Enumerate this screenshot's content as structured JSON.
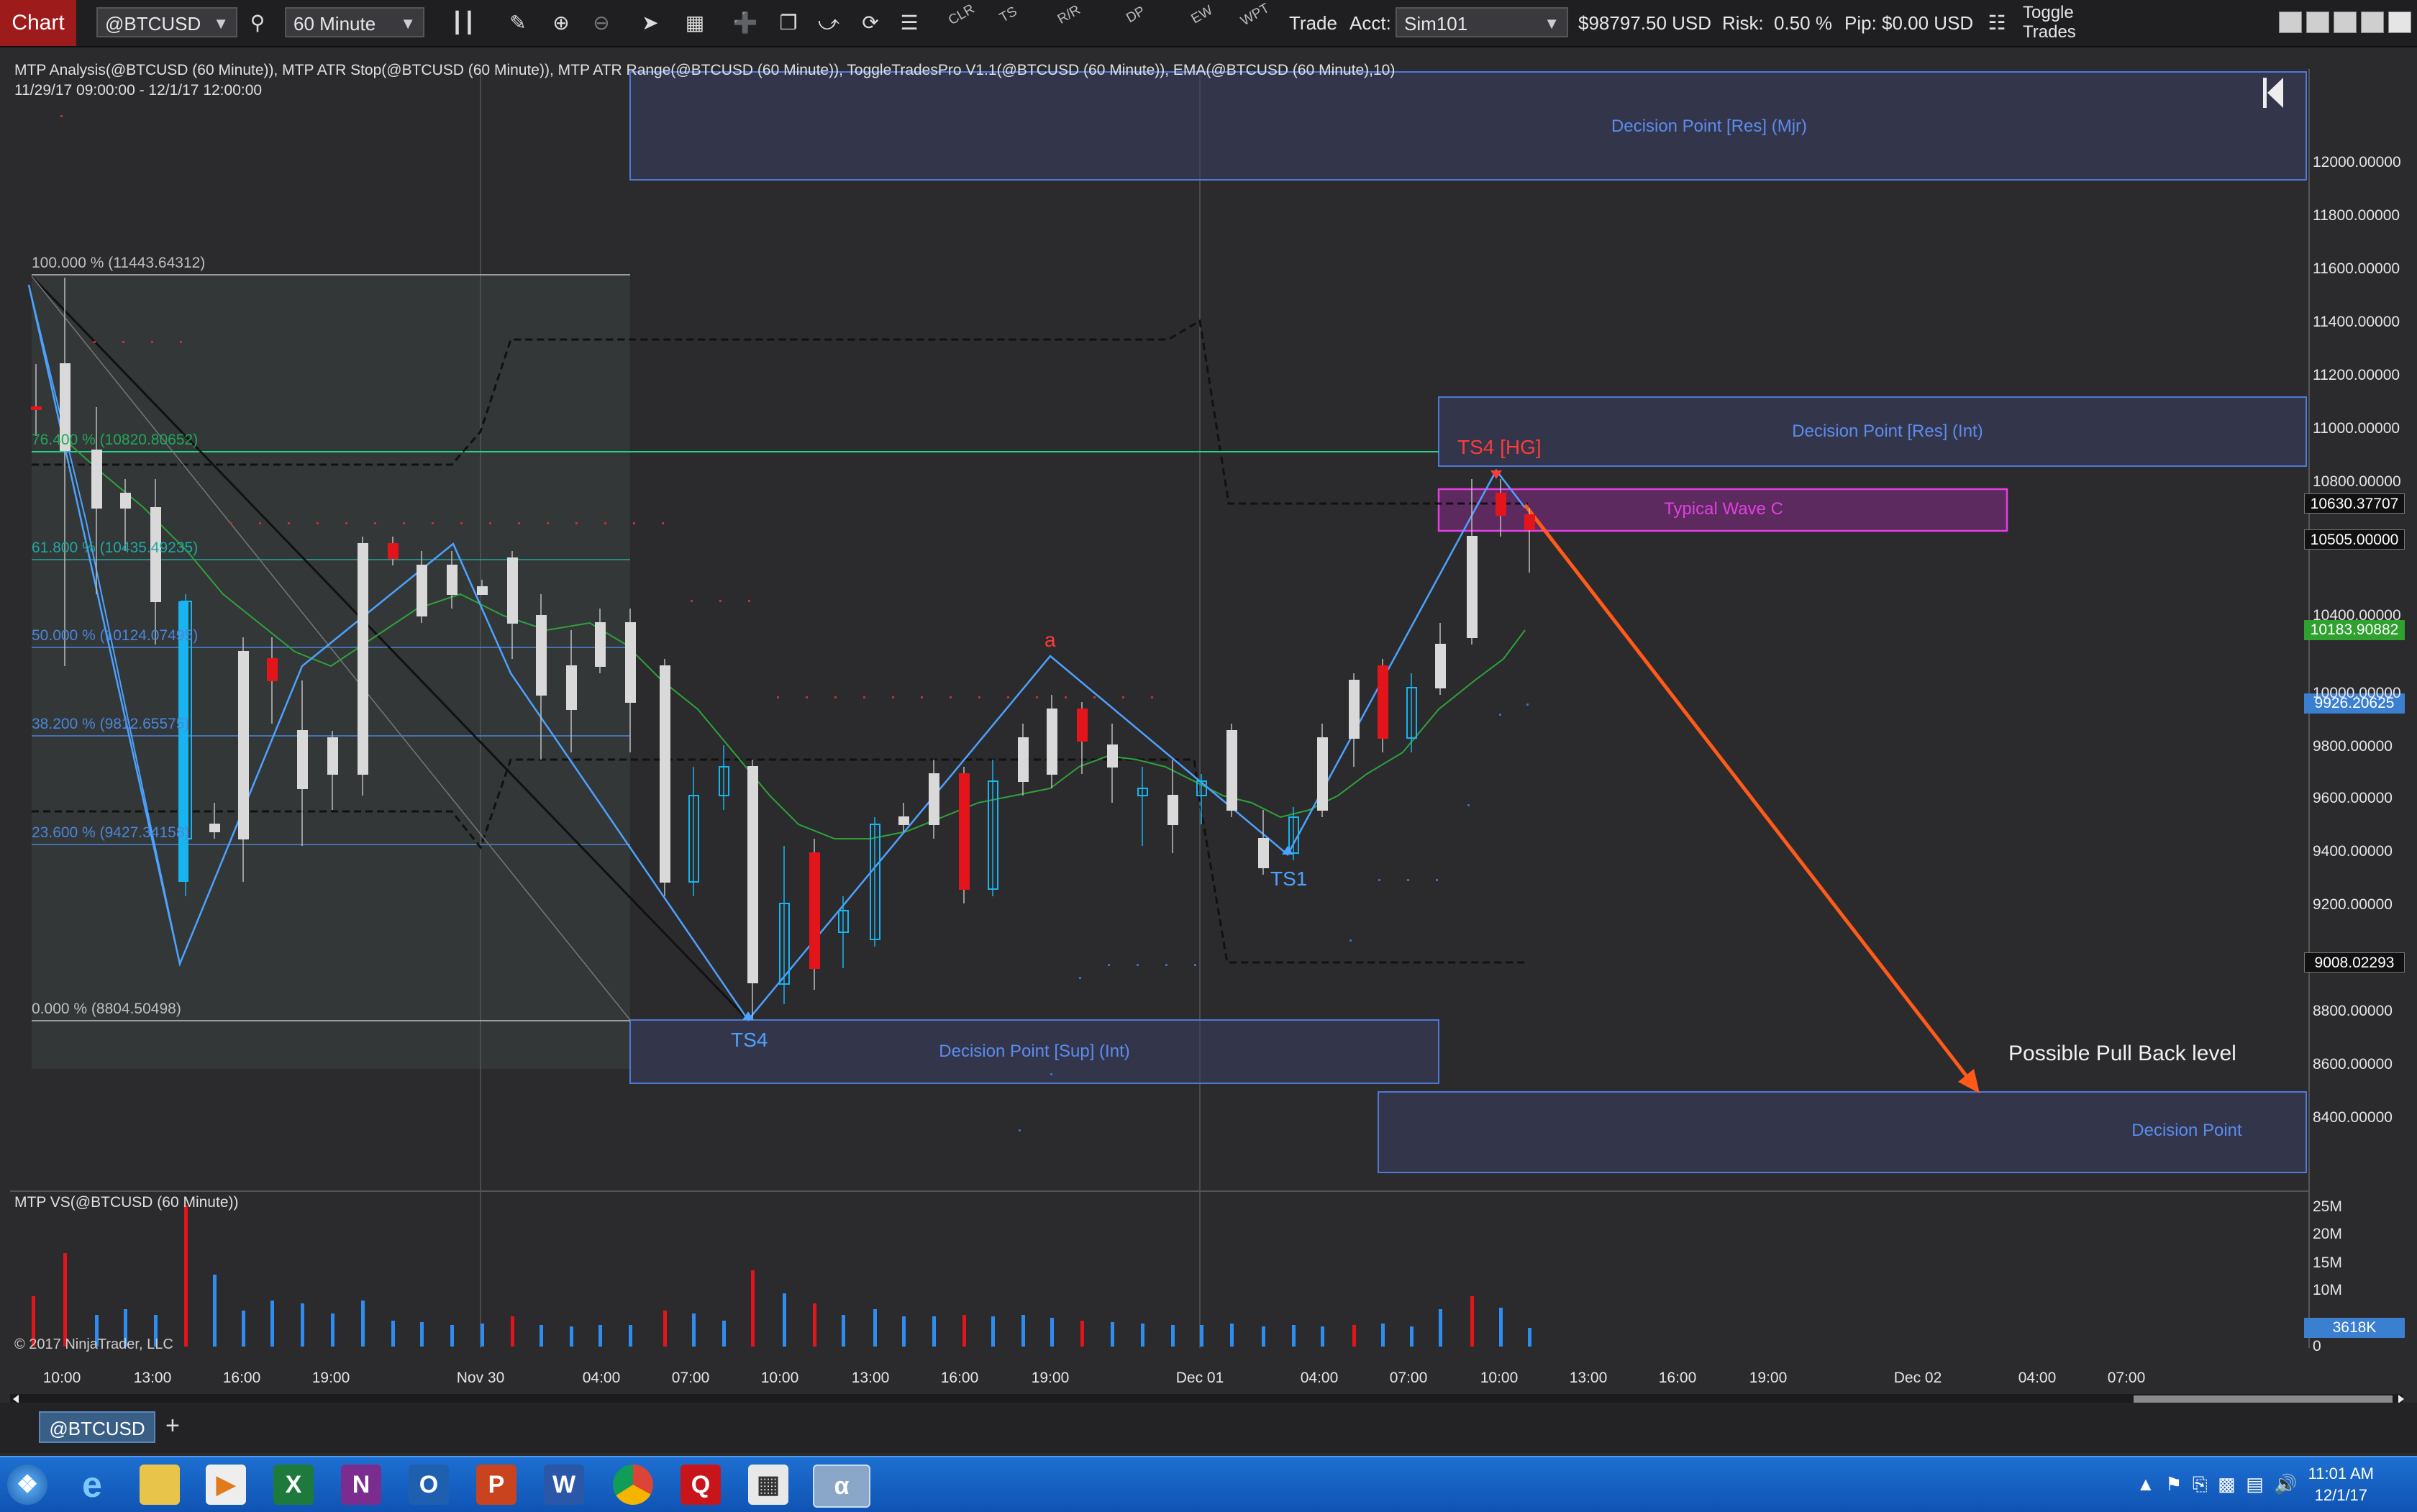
{
  "toolbar": {
    "tab_label": "Chart",
    "instrument": "@BTCUSD",
    "interval": "60 Minute",
    "mini_labels": [
      "CLR",
      "TS",
      "R/R",
      "DP",
      "EW",
      "WPT"
    ],
    "trade_label": "Trade",
    "account_label": "Acct:",
    "account_value": "Sim101",
    "balance": "$98797.50 USD",
    "risk_label": "Risk:",
    "risk_value": "0.50 %",
    "pip_label": "Pip:",
    "pip_value": "$0.00 USD",
    "toggle_trades": "Toggle Trades"
  },
  "chart_header": {
    "indicators": "MTP Analysis(@BTCUSD (60 Minute)), MTP ATR Stop(@BTCUSD (60 Minute)), MTP ATR Range(@BTCUSD (60 Minute)), ToggleTradesPro V1.1(@BTCUSD (60 Minute)), EMA(@BTCUSD (60 Minute),10)",
    "date_range": "11/29/17 09:00:00 - 12/1/17 12:00:00"
  },
  "price_axis": [
    "12000.00000",
    "11800.00000",
    "11600.00000",
    "11400.00000",
    "11200.00000",
    "11000.00000",
    "10800.00000",
    "10400.00000",
    "10000.00000",
    "9800.00000",
    "9600.00000",
    "9400.00000",
    "9200.00000",
    "8800.00000",
    "8600.00000",
    "8400.00000"
  ],
  "price_labels": {
    "label_1": "10630.37707",
    "label_2": "10505.00000",
    "ema_value": "10183.90882",
    "last_price": "9926.20625",
    "label_3": "9008.02293"
  },
  "fib_levels": [
    {
      "label": "100.000 % (11443.64312)",
      "color": "#bfbfbf"
    },
    {
      "label": "76.400 % (10820.80652)",
      "color": "#22a55a"
    },
    {
      "label": "61.800 % (10435.49235)",
      "color": "#1fa8a0"
    },
    {
      "label": "50.000 % (10124.07495)",
      "color": "#4b86d8"
    },
    {
      "label": "38.200 % (9812.65575)",
      "color": "#4b86d8"
    },
    {
      "label": "23.600 % (9427.34158)",
      "color": "#4b86d8"
    },
    {
      "label": "0.000 % (8804.50498)",
      "color": "#bfbfbf"
    }
  ],
  "zones": {
    "res_major": "Decision Point [Res] (Mjr)",
    "res_int": "Decision Point [Res] (Int)",
    "wave_c": "Typical Wave C",
    "sup_int": "Decision Point [Sup] (Int)",
    "decision_point": "Decision Point"
  },
  "annotations": {
    "ts4_hg": "TS4 [HG]",
    "ts4": "TS4",
    "ts1": "TS1",
    "wave_a": "a",
    "pull_back": "Possible Pull Back level"
  },
  "volume_panel": {
    "title": "MTP VS(@BTCUSD (60 Minute))",
    "axis": [
      "25M",
      "20M",
      "15M",
      "10M",
      "0"
    ],
    "current": "3618K",
    "copyright": "© 2017 NinjaTrader, LLC"
  },
  "time_axis": [
    "10:00",
    "13:00",
    "16:00",
    "19:00",
    "Nov 30",
    "04:00",
    "07:00",
    "10:00",
    "13:00",
    "16:00",
    "19:00",
    "Dec 01",
    "04:00",
    "07:00",
    "10:00",
    "13:00",
    "16:00",
    "19:00",
    "Dec 02",
    "04:00",
    "07:00"
  ],
  "instrument_tab": "@BTCUSD",
  "add_tab": "+",
  "taskbar": {
    "time": "11:01 AM",
    "date": "12/1/17"
  },
  "colors": {
    "accent_red": "#9e1b1b",
    "bull_candle": "#d9d9d9",
    "bear_candle": "#e4141b",
    "zone_blue": "#5b8cf0",
    "wave_magenta": "#e040e0",
    "arrow_orange": "#ff5a1a"
  }
}
